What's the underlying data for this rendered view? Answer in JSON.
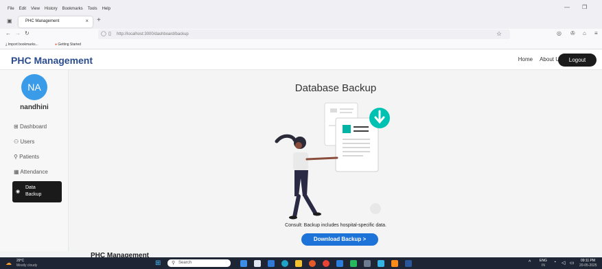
{
  "browser": {
    "menu": [
      "File",
      "Edit",
      "View",
      "History",
      "Bookmarks",
      "Tools",
      "Help"
    ],
    "tab_title": "PHC Management",
    "url": "http://localhost:3000/dashboard/backup",
    "bookmarks": [
      "Import bookmarks...",
      "Getting Started"
    ]
  },
  "app": {
    "brand": "PHC Management",
    "nav": {
      "home": "Home",
      "about": "About Us",
      "logout": "Logout"
    }
  },
  "sidebar": {
    "avatar_initials": "NA",
    "username": "nandhini",
    "items": [
      {
        "label": "Dashboard",
        "icon": "grid-icon"
      },
      {
        "label": "Users",
        "icon": "users-icon"
      },
      {
        "label": "Patients",
        "icon": "patients-icon"
      },
      {
        "label": "Attendance",
        "icon": "calendar-icon"
      },
      {
        "label": "Data Backup",
        "icon": "backup-icon",
        "active": true
      }
    ]
  },
  "main": {
    "title": "Database Backup",
    "consult": "Consult: Backup includes hospital-specific data.",
    "button": "Download Backup  >"
  },
  "footer": {
    "title": "PHC Management"
  },
  "taskbar": {
    "weather_temp": "29°C",
    "weather_desc": "Mostly cloudy",
    "search": "Search",
    "lang": "ENG",
    "region": "IN",
    "time": "09:11 PM",
    "date": "20-05-2025"
  },
  "colors": {
    "brand": "#2a4b8d",
    "primary": "#1e73d9",
    "accent": "#00b3a4",
    "avatar": "#3a9be8"
  }
}
